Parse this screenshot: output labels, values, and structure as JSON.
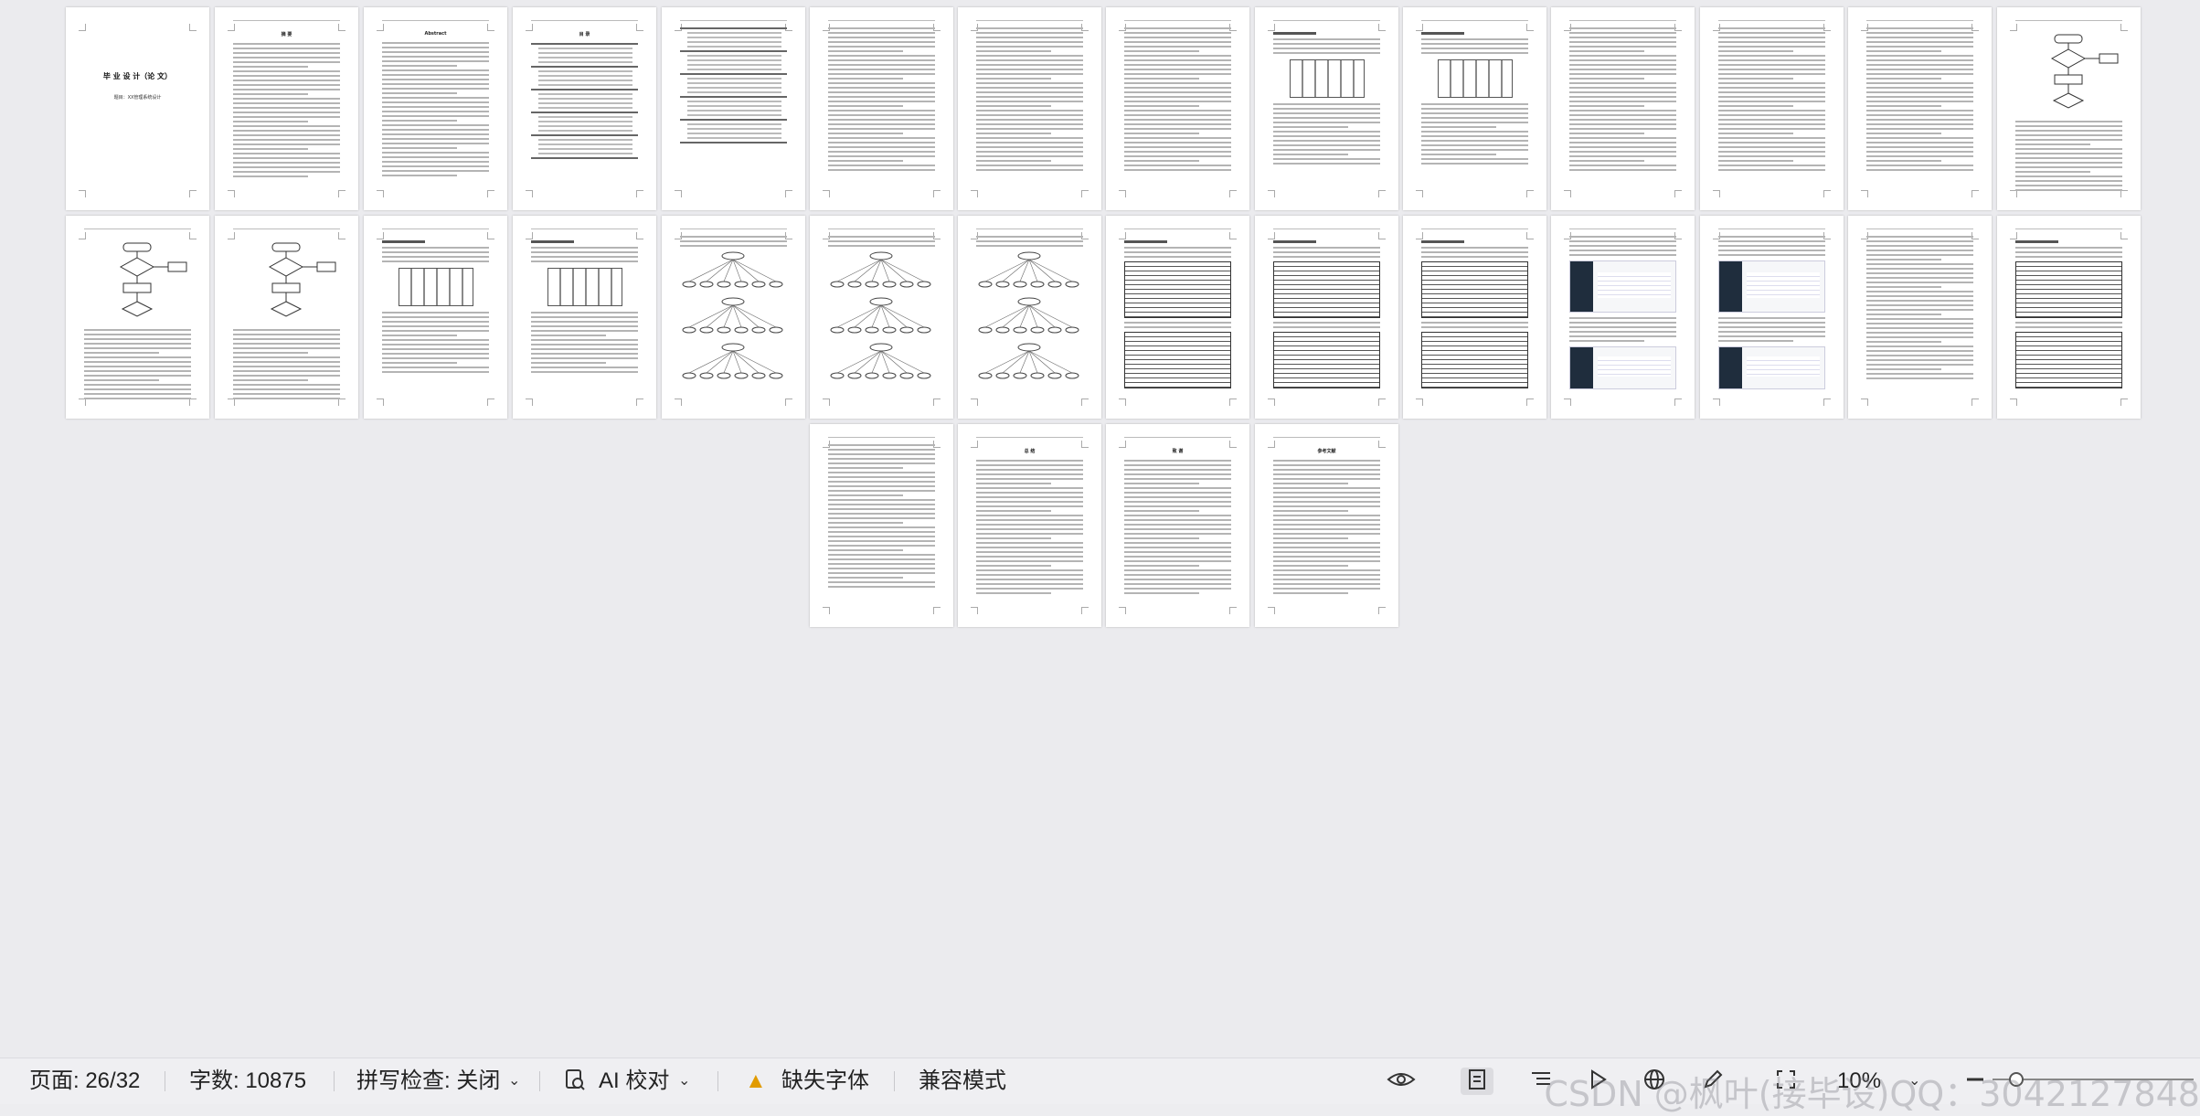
{
  "pages": [
    {
      "type": "cover",
      "title": "毕 业 设 计（论 文）",
      "subtitle": "题目：XX管理系统设计"
    },
    {
      "type": "text",
      "heading": "摘 要"
    },
    {
      "type": "text",
      "heading": "Abstract"
    },
    {
      "type": "toc",
      "heading": "目 录"
    },
    {
      "type": "toc"
    },
    {
      "type": "text"
    },
    {
      "type": "text"
    },
    {
      "type": "text"
    },
    {
      "type": "diagram"
    },
    {
      "type": "diagram"
    },
    {
      "type": "text"
    },
    {
      "type": "text"
    },
    {
      "type": "text"
    },
    {
      "type": "flowchart"
    },
    {
      "type": "flowchart"
    },
    {
      "type": "flowchart"
    },
    {
      "type": "diagram"
    },
    {
      "type": "diagram"
    },
    {
      "type": "tree"
    },
    {
      "type": "tree"
    },
    {
      "type": "tree"
    },
    {
      "type": "table"
    },
    {
      "type": "table"
    },
    {
      "type": "table"
    },
    {
      "type": "screenshot"
    },
    {
      "type": "screenshot"
    },
    {
      "type": "text"
    },
    {
      "type": "table"
    },
    {
      "type": "text"
    },
    {
      "type": "text",
      "heading": "总 结"
    },
    {
      "type": "text",
      "heading": "致 谢"
    },
    {
      "type": "text",
      "heading": "参考文献"
    }
  ],
  "status": {
    "page": "页面: 26/32",
    "words": "字数: 10875",
    "spell": "拼写检查: 关闭",
    "ai": "AI 校对",
    "missing_font": "缺失字体",
    "compat": "兼容模式",
    "zoom": "10%"
  },
  "watermark": "CSDN @枫叶(接毕设)QQ：3042127848",
  "icons": {
    "spell_dropdown": "chevron-down-icon",
    "ai": "ai-check-icon",
    "warning": "warning-icon",
    "eye": "eye-icon",
    "page_view": "page-view-icon",
    "outline": "outline-icon",
    "play": "play-icon",
    "web": "web-layout-icon",
    "pen": "pen-icon",
    "fit": "fit-page-icon"
  },
  "colors": {
    "warning": "#e19b00",
    "statusbar_bg": "#efeff2",
    "workspace_bg": "#ebebee"
  }
}
